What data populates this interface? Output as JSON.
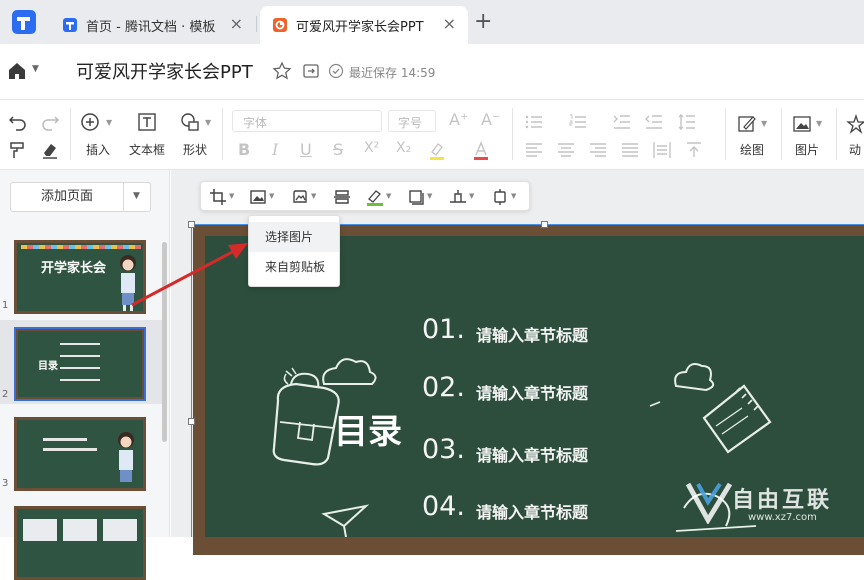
{
  "tabs": [
    {
      "label": "首页 - 腾讯文档 · 模板",
      "close": "×"
    },
    {
      "label": "可爱风开学家长会PPT",
      "close": "×"
    }
  ],
  "new_tab": "+",
  "title_bar": {
    "title": "可爱风开学家长会PPT",
    "save_status": "最近保存 14:59"
  },
  "toolbar": {
    "insert_label": "插入",
    "textbox_label": "文本框",
    "shape_label": "形状",
    "font_placeholder": "字体",
    "size_placeholder": "字号",
    "draw_label": "绘图",
    "image_label": "图片",
    "animation_label": "动"
  },
  "left_panel": {
    "add_page_label": "添加页面",
    "thumb_numbers": [
      "1",
      "2",
      "3"
    ],
    "thumb1_title": "开学家长会",
    "thumb2_title": "目录"
  },
  "image_dropdown": {
    "items": [
      "选择图片",
      "来自剪贴板"
    ]
  },
  "slide": {
    "title": "目录",
    "items": [
      {
        "num": "01.",
        "text": "请输入章节标题"
      },
      {
        "num": "02.",
        "text": "请输入章节标题"
      },
      {
        "num": "03.",
        "text": "请输入章节标题"
      },
      {
        "num": "04.",
        "text": "请输入章节标题"
      }
    ]
  },
  "watermark": {
    "text": "自由互联",
    "url": "www.xz7.com"
  },
  "colors": {
    "chalkboard": "#2d4e3c",
    "frame": "#6a4e35",
    "selection": "#4a90e2",
    "arrow": "#d42a2a",
    "active_tab_icon": "#f0622c",
    "logo": "#2b6cf0"
  }
}
